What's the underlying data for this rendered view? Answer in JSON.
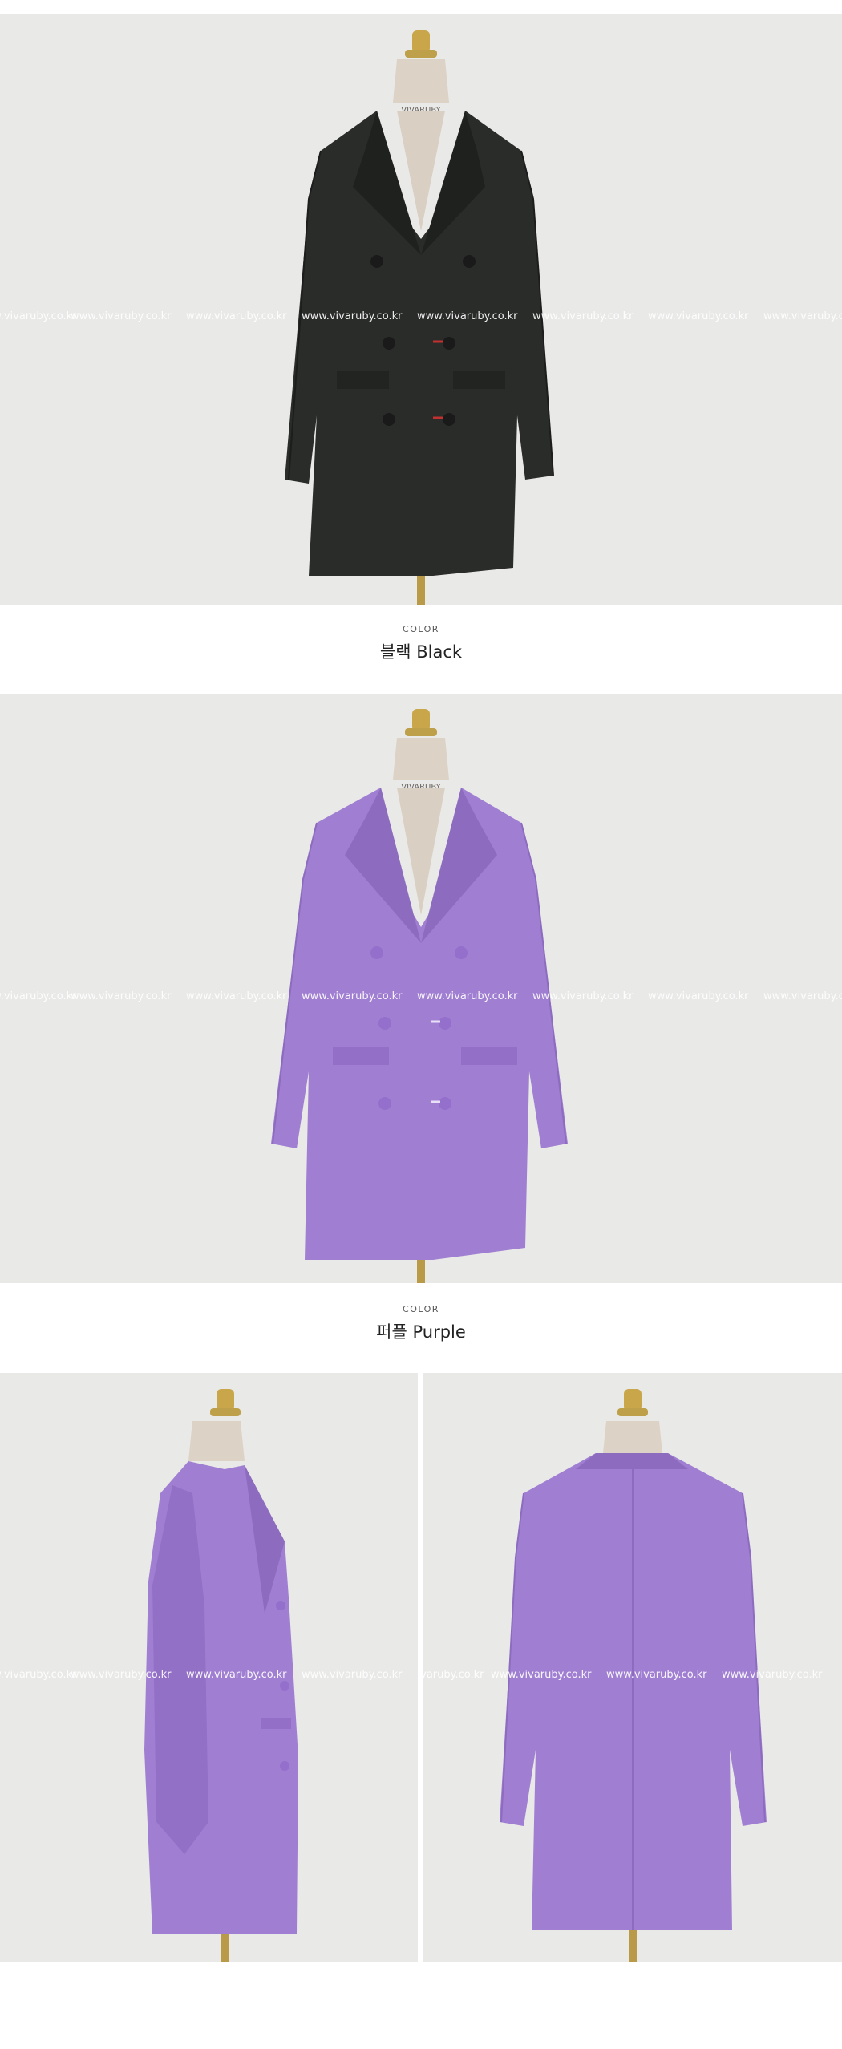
{
  "watermark": "www.vivaruby.co.kr",
  "mannequin_tag": "VIVARUBY",
  "colors": {
    "black": {
      "kicker": "COLOR",
      "name": "블랙 Black",
      "swatch": "#2a2c2a"
    },
    "purple": {
      "kicker": "COLOR",
      "name": "퍼플 Purple",
      "swatch": "#a07fd2"
    }
  },
  "photos": {
    "black_front": {
      "icon": "mannequin-dress-black-front"
    },
    "purple_front": {
      "icon": "mannequin-dress-purple-front"
    },
    "purple_side": {
      "icon": "mannequin-dress-purple-side"
    },
    "purple_back": {
      "icon": "mannequin-dress-purple-back"
    }
  },
  "palette": {
    "background": "#e9e9e7",
    "mannequin_neck": "#d9cfc3",
    "mannequin_cap": "#c9a64a",
    "pole": "#b99a48",
    "purple_shadow": "#8d6cc0"
  }
}
